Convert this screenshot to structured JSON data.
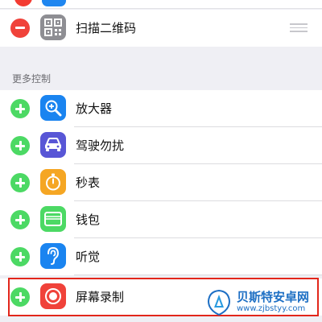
{
  "enabled_controls": [
    {
      "label": "扫描二维码",
      "icon": "qr-code-icon",
      "icon_color": "#8e8e93"
    }
  ],
  "more_controls": {
    "header": "更多控制",
    "items": [
      {
        "label": "放大器",
        "icon": "magnifier-icon",
        "icon_color": "#1a84f0"
      },
      {
        "label": "驾驶勿扰",
        "icon": "car-icon",
        "icon_color": "#5856d6"
      },
      {
        "label": "秒表",
        "icon": "stopwatch-icon",
        "icon_color": "#f5a623"
      },
      {
        "label": "钱包",
        "icon": "wallet-icon",
        "icon_color": "#4cd964"
      },
      {
        "label": "听觉",
        "icon": "ear-icon",
        "icon_color": "#1a84f0"
      },
      {
        "label": "屏幕录制",
        "icon": "screen-record-icon",
        "icon_color": "#f0423a"
      }
    ]
  },
  "watermark": {
    "title": "贝斯特安卓网",
    "url": "www.zjbstyy.com"
  },
  "colors": {
    "add": "#4cd964",
    "remove": "#f0423a",
    "highlight": "#e2261b"
  }
}
